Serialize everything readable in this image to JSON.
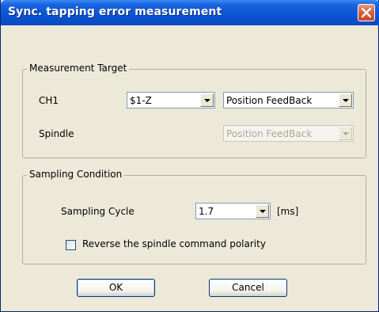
{
  "window": {
    "title": "Sync. tapping error measurement"
  },
  "measurement_target": {
    "legend": "Measurement Target",
    "ch1": {
      "label": "CH1",
      "axis_value": "$1-Z",
      "signal_value": "Position FeedBack"
    },
    "spindle": {
      "label": "Spindle",
      "signal_value": "Position FeedBack"
    }
  },
  "sampling_condition": {
    "legend": "Sampling Condition",
    "cycle_label": "Sampling Cycle",
    "cycle_value": "1.7",
    "cycle_unit": "[ms]",
    "reverse_checkbox_label": "Reverse the spindle command polarity",
    "reverse_checked": false
  },
  "buttons": {
    "ok": "OK",
    "cancel": "Cancel"
  },
  "icons": {
    "close": "close-icon",
    "dropdown": "chevron-down-icon"
  },
  "colors": {
    "titlebar": "#0b55d6",
    "dialog_bg": "#ece9d8",
    "close_button": "#d8653f"
  }
}
